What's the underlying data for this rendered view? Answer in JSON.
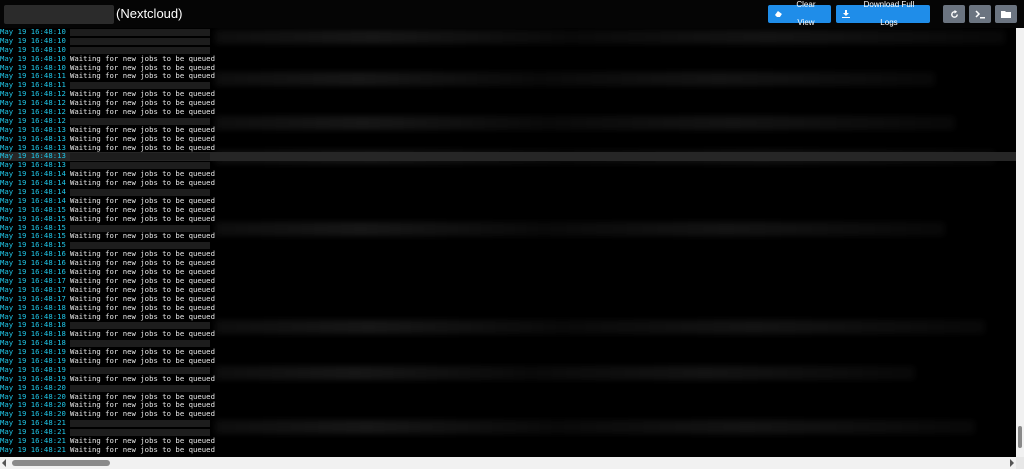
{
  "header": {
    "title_suffix": "(Nextcloud)",
    "buttons": {
      "clear_view": "Clear View",
      "download_full_logs": "Download Full Logs"
    },
    "colors": {
      "primary": "#1f8de9",
      "secondary": "#6b7480",
      "timestamp": "#1fc6e8"
    },
    "icons": [
      "clear-icon",
      "download-icon",
      "refresh-icon",
      "terminal-icon",
      "folder-icon"
    ]
  },
  "log": {
    "lines": [
      {
        "ts": "May 19 16:48:10",
        "msg": ""
      },
      {
        "ts": "May 19 16:48:10",
        "msg": ""
      },
      {
        "ts": "May 19 16:48:10",
        "msg": ""
      },
      {
        "ts": "May 19 16:48:10",
        "msg": "Waiting for new jobs to be queued"
      },
      {
        "ts": "May 19 16:48:10",
        "msg": "Waiting for new jobs to be queued"
      },
      {
        "ts": "May 19 16:48:11",
        "msg": "Waiting for new jobs to be queued"
      },
      {
        "ts": "May 19 16:48:11",
        "msg": ""
      },
      {
        "ts": "May 19 16:48:12",
        "msg": "Waiting for new jobs to be queued"
      },
      {
        "ts": "May 19 16:48:12",
        "msg": "Waiting for new jobs to be queued"
      },
      {
        "ts": "May 19 16:48:12",
        "msg": "Waiting for new jobs to be queued"
      },
      {
        "ts": "May 19 16:48:12",
        "msg": ""
      },
      {
        "ts": "May 19 16:48:13",
        "msg": "Waiting for new jobs to be queued"
      },
      {
        "ts": "May 19 16:48:13",
        "msg": "Waiting for new jobs to be queued"
      },
      {
        "ts": "May 19 16:48:13",
        "msg": "Waiting for new jobs to be queued"
      },
      {
        "ts": "May 19 16:48:13",
        "msg": "",
        "highlight": true
      },
      {
        "ts": "May 19 16:48:13",
        "msg": ""
      },
      {
        "ts": "May 19 16:48:14",
        "msg": "Waiting for new jobs to be queued"
      },
      {
        "ts": "May 19 16:48:14",
        "msg": "Waiting for new jobs to be queued"
      },
      {
        "ts": "May 19 16:48:14",
        "msg": ""
      },
      {
        "ts": "May 19 16:48:14",
        "msg": "Waiting for new jobs to be queued"
      },
      {
        "ts": "May 19 16:48:15",
        "msg": "Waiting for new jobs to be queued"
      },
      {
        "ts": "May 19 16:48:15",
        "msg": "Waiting for new jobs to be queued"
      },
      {
        "ts": "May 19 16:48:15",
        "msg": ""
      },
      {
        "ts": "May 19 16:48:15",
        "msg": "Waiting for new jobs to be queued"
      },
      {
        "ts": "May 19 16:48:15",
        "msg": ""
      },
      {
        "ts": "May 19 16:48:16",
        "msg": "Waiting for new jobs to be queued"
      },
      {
        "ts": "May 19 16:48:16",
        "msg": "Waiting for new jobs to be queued"
      },
      {
        "ts": "May 19 16:48:16",
        "msg": "Waiting for new jobs to be queued"
      },
      {
        "ts": "May 19 16:48:17",
        "msg": "Waiting for new jobs to be queued"
      },
      {
        "ts": "May 19 16:48:17",
        "msg": "Waiting for new jobs to be queued"
      },
      {
        "ts": "May 19 16:48:17",
        "msg": "Waiting for new jobs to be queued"
      },
      {
        "ts": "May 19 16:48:18",
        "msg": "Waiting for new jobs to be queued"
      },
      {
        "ts": "May 19 16:48:18",
        "msg": "Waiting for new jobs to be queued"
      },
      {
        "ts": "May 19 16:48:18",
        "msg": ""
      },
      {
        "ts": "May 19 16:48:18",
        "msg": "Waiting for new jobs to be queued"
      },
      {
        "ts": "May 19 16:48:18",
        "msg": ""
      },
      {
        "ts": "May 19 16:48:19",
        "msg": "Waiting for new jobs to be queued"
      },
      {
        "ts": "May 19 16:48:19",
        "msg": "Waiting for new jobs to be queued"
      },
      {
        "ts": "May 19 16:48:19",
        "msg": ""
      },
      {
        "ts": "May 19 16:48:19",
        "msg": "Waiting for new jobs to be queued"
      },
      {
        "ts": "May 19 16:48:20",
        "msg": ""
      },
      {
        "ts": "May 19 16:48:20",
        "msg": "Waiting for new jobs to be queued"
      },
      {
        "ts": "May 19 16:48:20",
        "msg": "Waiting for new jobs to be queued"
      },
      {
        "ts": "May 19 16:48:20",
        "msg": "Waiting for new jobs to be queued"
      },
      {
        "ts": "May 19 16:48:21",
        "msg": ""
      },
      {
        "ts": "May 19 16:48:21",
        "msg": ""
      },
      {
        "ts": "May 19 16:48:21",
        "msg": "Waiting for new jobs to be queued"
      },
      {
        "ts": "May 19 16:48:21",
        "msg": "Waiting for new jobs to be queued"
      }
    ]
  }
}
